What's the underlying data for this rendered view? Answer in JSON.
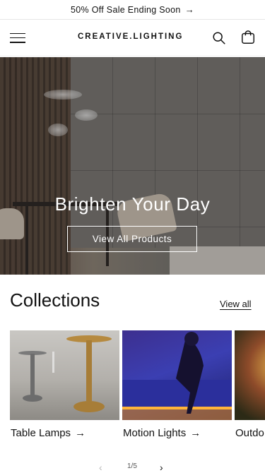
{
  "announcement": {
    "text": "50% Off Sale Ending Soon",
    "arrow_icon": "arrow-right-icon"
  },
  "header": {
    "logo": "CREATIVE.LIGHTING",
    "menu_icon": "hamburger-menu-icon",
    "search_icon": "search-icon",
    "cart_icon": "shopping-bag-icon"
  },
  "hero": {
    "heading": "Brighten Your Day",
    "cta_label": "View All Products"
  },
  "collections": {
    "title": "Collections",
    "view_all": "View all",
    "items": [
      {
        "label": "Table Lamps"
      },
      {
        "label": "Motion Lights"
      },
      {
        "label": "Outdo"
      }
    ],
    "pagination": {
      "current": "1",
      "total": "5",
      "text": "1/5"
    }
  },
  "colors": {
    "text": "#121212",
    "background": "#ffffff",
    "border": "#e6e6e6"
  }
}
